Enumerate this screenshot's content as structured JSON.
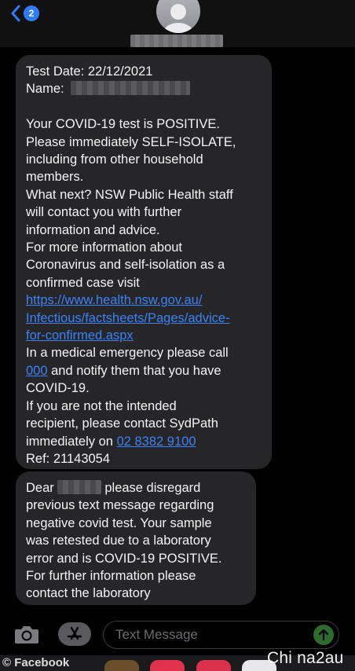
{
  "header": {
    "back_icon": "chevron-left-icon",
    "unread_count": "2",
    "avatar_icon": "person-silhouette-icon"
  },
  "messages": [
    {
      "lines": {
        "test_date": "Test Date: 22/12/2021",
        "name_label": "Name:",
        "l1": "Your COVID-19 test is POSITIVE.",
        "l2": "Please immediately SELF-ISOLATE,",
        "l3": "including from other household",
        "l4": "members.",
        "l5": "What next? NSW Public Health staff",
        "l6": "will contact you with further",
        "l7": "information and advice.",
        "l8": "For more information about",
        "l9": "Coronavirus and self-isolation as a",
        "l10": "confirmed case visit",
        "link1": "https://www.health.nsw.gov.au/",
        "link2": "Infectious/factsheets/Pages/advice-",
        "link3": "for-confirmed.aspx",
        "l11": "In a medical emergency please call",
        "emergency_number": "000",
        "l12_rest": " and notify them that you have",
        "l13": "COVID-19.",
        "l14": "If you are not the intended",
        "l15": "recipient, please contact SydPath",
        "l16_pre": "immediately on ",
        "phone": "02 8382 9100",
        "ref": "Ref: 21143054"
      }
    },
    {
      "lines": {
        "dear": "Dear",
        "l1_rest": " please disregard",
        "l2": "previous text message regarding",
        "l3": "negative covid test. Your sample",
        "l4": "was retested due to a laboratory",
        "l5": "error and is COVID-19 POSITIVE.",
        "l6": "For further information please",
        "l7": "contact the laboratory"
      }
    }
  ],
  "input_bar": {
    "placeholder": "Text Message",
    "camera_icon": "camera-icon",
    "apps_icon": "app-store-icon",
    "send_icon": "send-arrow-icon"
  },
  "bottom": {
    "credit": "© Facebook",
    "watermark": "Chi na2au"
  },
  "colors": {
    "bubble": "#262628",
    "link": "#3b82f7",
    "badge": "#2f7cf6"
  }
}
